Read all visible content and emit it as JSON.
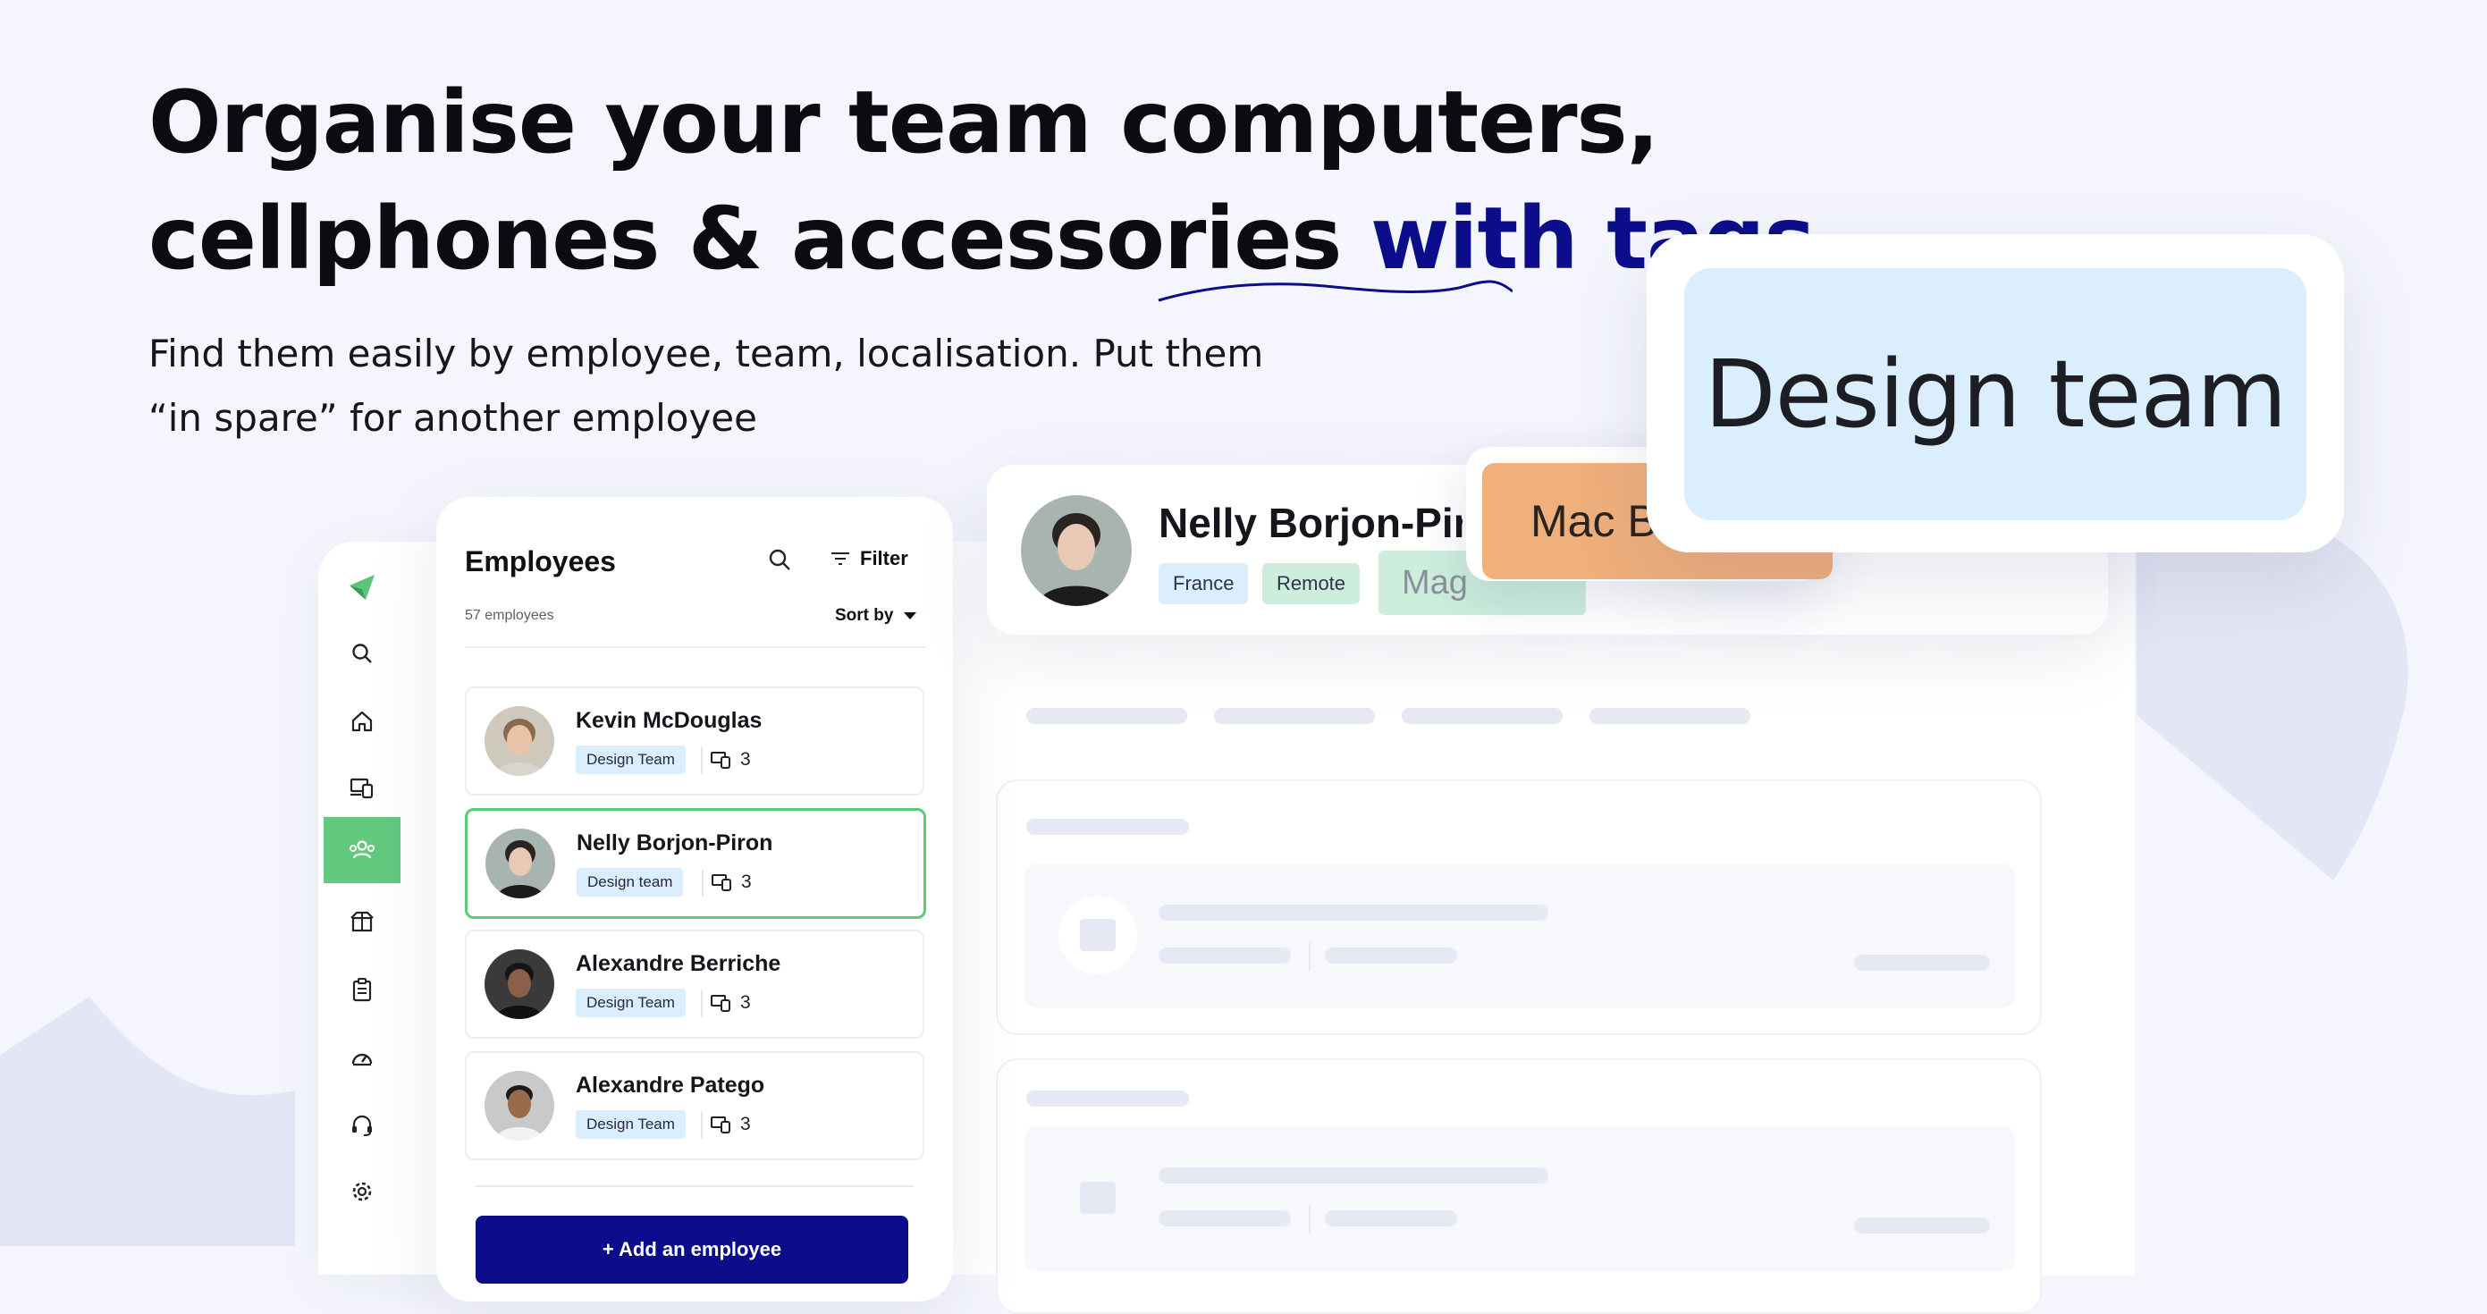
{
  "hero": {
    "headline_line1": "Organise your team computers,",
    "headline_line2": "cellphones & accessories ",
    "headline_accent": "with tags",
    "subtitle_line1": "Find them easily by employee, team, localisation. Put them",
    "subtitle_line2": "“in spare” for another employee"
  },
  "colors": {
    "brand": "#0c0d8a",
    "active_green": "#63c97e",
    "tag_blue": "#dbeefd",
    "tag_green": "#cdeedd",
    "tag_orange": "#f0b07c"
  },
  "sidebar": {
    "items": [
      {
        "icon": "logo-icon"
      },
      {
        "icon": "search-icon"
      },
      {
        "icon": "home-icon"
      },
      {
        "icon": "devices-icon"
      },
      {
        "icon": "employees-icon",
        "active": true
      },
      {
        "icon": "package-icon"
      },
      {
        "icon": "clipboard-icon"
      },
      {
        "icon": "dashboard-icon"
      },
      {
        "icon": "support-icon"
      },
      {
        "icon": "gear-icon"
      }
    ]
  },
  "employees": {
    "title": "Employees",
    "count_label": "57 employees",
    "filter_label": "Filter",
    "sort_label": "Sort by",
    "add_button": "+ Add an employee",
    "list": [
      {
        "name": "Kevin McDouglas",
        "tag": "Design Team",
        "devices": "3"
      },
      {
        "name": "Nelly Borjon-Piron",
        "tag": "Design team",
        "devices": "3",
        "selected": true
      },
      {
        "name": "Alexandre Berriche",
        "tag": "Design Team",
        "devices": "3"
      },
      {
        "name": "Alexandre Patego",
        "tag": "Design Team",
        "devices": "3"
      }
    ]
  },
  "profile": {
    "name": "Nelly Borjon-Piron",
    "tags": [
      "France",
      "Remote",
      "Mag"
    ],
    "floating_tag_mac": "Mac B",
    "floating_tag_design": "Design team"
  }
}
